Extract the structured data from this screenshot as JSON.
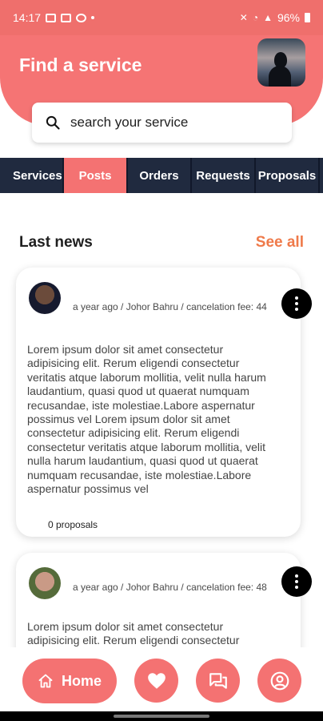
{
  "status": {
    "time": "14:17",
    "battery": "96%"
  },
  "header": {
    "title": "Find a service"
  },
  "search": {
    "label": "search your service"
  },
  "tabs": [
    {
      "label": "Services"
    },
    {
      "label": "Posts"
    },
    {
      "label": "Orders"
    },
    {
      "label": "Requests"
    },
    {
      "label": "Proposals"
    }
  ],
  "section": {
    "title": "Last news",
    "see_all": "See all"
  },
  "posts": [
    {
      "meta": "a year ago / Johor Bahru / cancelation fee: 44",
      "text": "Lorem ipsum dolor sit amet consectetur adipisicing elit. Rerum eligendi consectetur veritatis atque laborum mollitia, velit nulla harum laudantium, quasi quod ut quaerat numquam recusandae, iste molestiae.Labore aspernatur possimus vel Lorem ipsum dolor sit amet consectetur adipisicing elit. Rerum eligendi consectetur veritatis atque laborum mollitia, velit nulla harum laudantium, quasi quod ut quaerat numquam recusandae, iste molestiae.Labore aspernatur possimus vel",
      "proposals": "0 proposals"
    },
    {
      "meta": "a year ago / Johor Bahru / cancelation fee: 48",
      "text": "Lorem ipsum dolor sit amet consectetur adipisicing elit. Rerum eligendi consectetur"
    }
  ],
  "bottom_nav": {
    "home_label": "Home"
  },
  "colors": {
    "primary": "#f47272",
    "tabs_bg": "#202a3f",
    "see_all": "#ef7a4a"
  }
}
